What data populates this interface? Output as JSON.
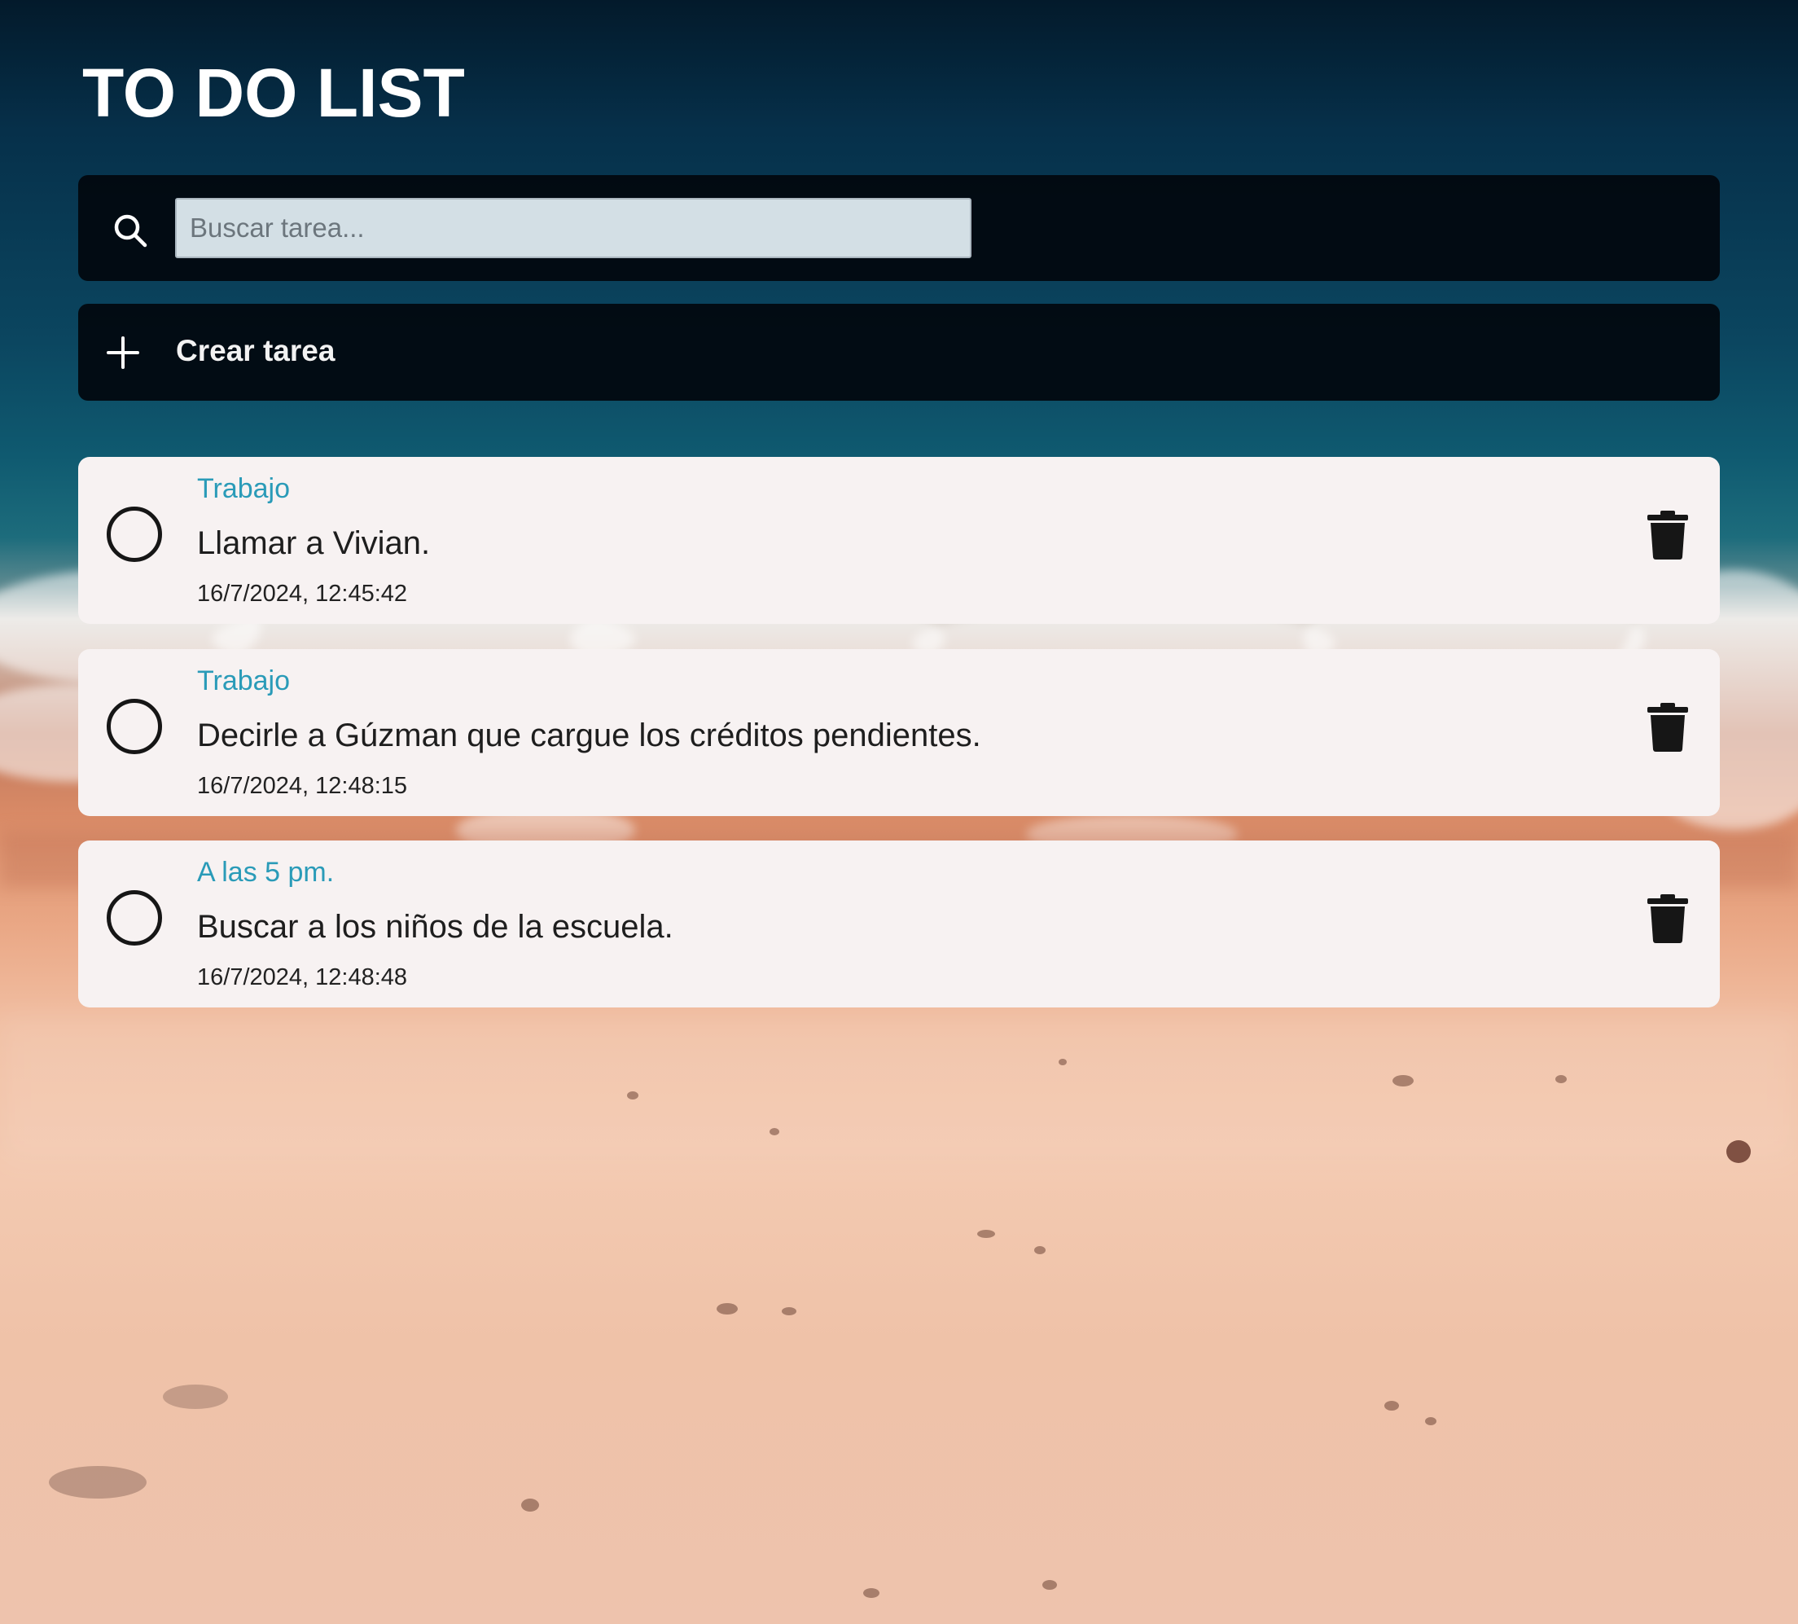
{
  "app": {
    "title": "TO DO LIST"
  },
  "search": {
    "placeholder": "Buscar tarea...",
    "value": "",
    "icon": "search-icon"
  },
  "create": {
    "label": "Crear tarea",
    "icon": "plus-icon"
  },
  "tasks": [
    {
      "category": "Trabajo",
      "text": "Llamar a Vivian.",
      "date": "16/7/2024, 12:45:42",
      "completed": false
    },
    {
      "category": "Trabajo",
      "text": "Decirle a Gúzman que cargue los créditos pendientes.",
      "date": "16/7/2024, 12:48:15",
      "completed": false
    },
    {
      "category": "A las 5 pm.",
      "text": "Buscar a los niños de la escuela.",
      "date": "16/7/2024, 12:48:48",
      "completed": false
    }
  ],
  "colors": {
    "category": "#2a9bb8",
    "panel": "#02080e",
    "card": "#f7f2f2",
    "text": "#1e1e1e"
  }
}
